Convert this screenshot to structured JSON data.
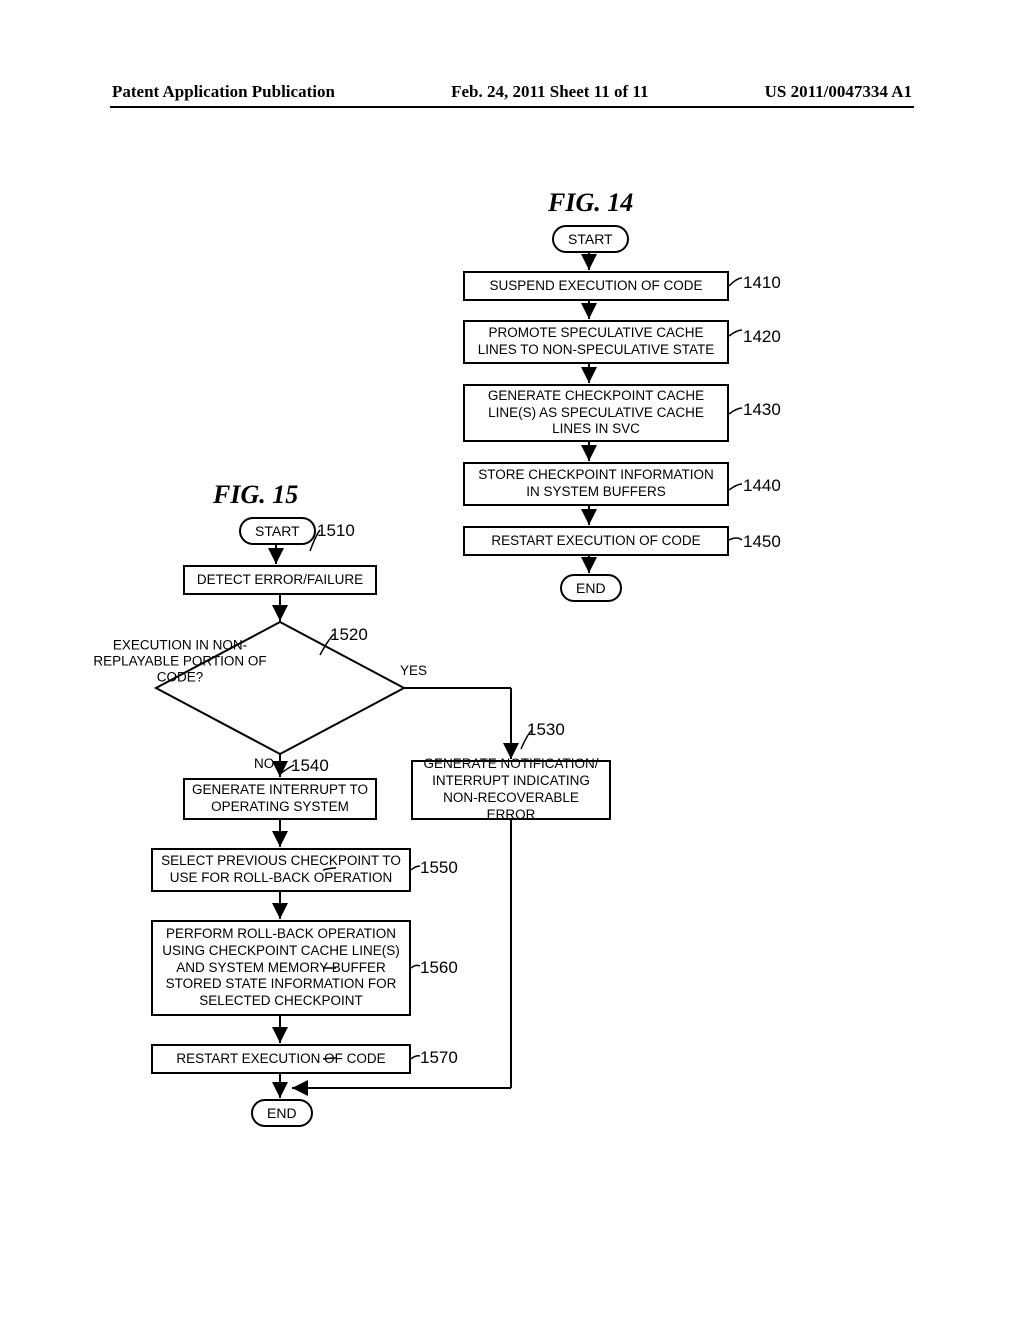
{
  "header": {
    "left": "Patent Application Publication",
    "center": "Feb. 24, 2011  Sheet 11 of 11",
    "right": "US 2011/0047334 A1"
  },
  "fig14": {
    "title": "FIG. 14",
    "start": "START",
    "end": "END",
    "b1410": "SUSPEND EXECUTION OF CODE",
    "b1420": "PROMOTE SPECULATIVE CACHE LINES TO NON-SPECULATIVE STATE",
    "b1430": "GENERATE CHECKPOINT CACHE LINE(S) AS SPECULATIVE CACHE LINES IN SVC",
    "b1440": "STORE CHECKPOINT INFORMATION IN SYSTEM BUFFERS",
    "b1450": "RESTART EXECUTION OF CODE",
    "r1410": "1410",
    "r1420": "1420",
    "r1430": "1430",
    "r1440": "1440",
    "r1450": "1450"
  },
  "fig15": {
    "title": "FIG. 15",
    "start": "START",
    "end": "END",
    "b1510": "DETECT ERROR/FAILURE",
    "d1520": "EXECUTION IN NON-REPLAYABLE PORTION OF CODE?",
    "yes": "YES",
    "no": "NO",
    "b1530": "GENERATE NOTIFICATION/ INTERRUPT INDICATING NON-RECOVERABLE ERROR",
    "b1540": "GENERATE INTERRUPT TO OPERATING SYSTEM",
    "b1550": "SELECT PREVIOUS CHECKPOINT TO USE FOR ROLL-BACK OPERATION",
    "b1560": "PERFORM ROLL-BACK OPERATION USING CHECKPOINT CACHE LINE(S) AND SYSTEM MEMORY BUFFER STORED STATE INFORMATION FOR SELECTED CHECKPOINT",
    "b1570": "RESTART EXECUTION OF CODE",
    "r1510": "1510",
    "r1520": "1520",
    "r1530": "1530",
    "r1540": "1540",
    "r1550": "1550",
    "r1560": "1560",
    "r1570": "1570"
  }
}
